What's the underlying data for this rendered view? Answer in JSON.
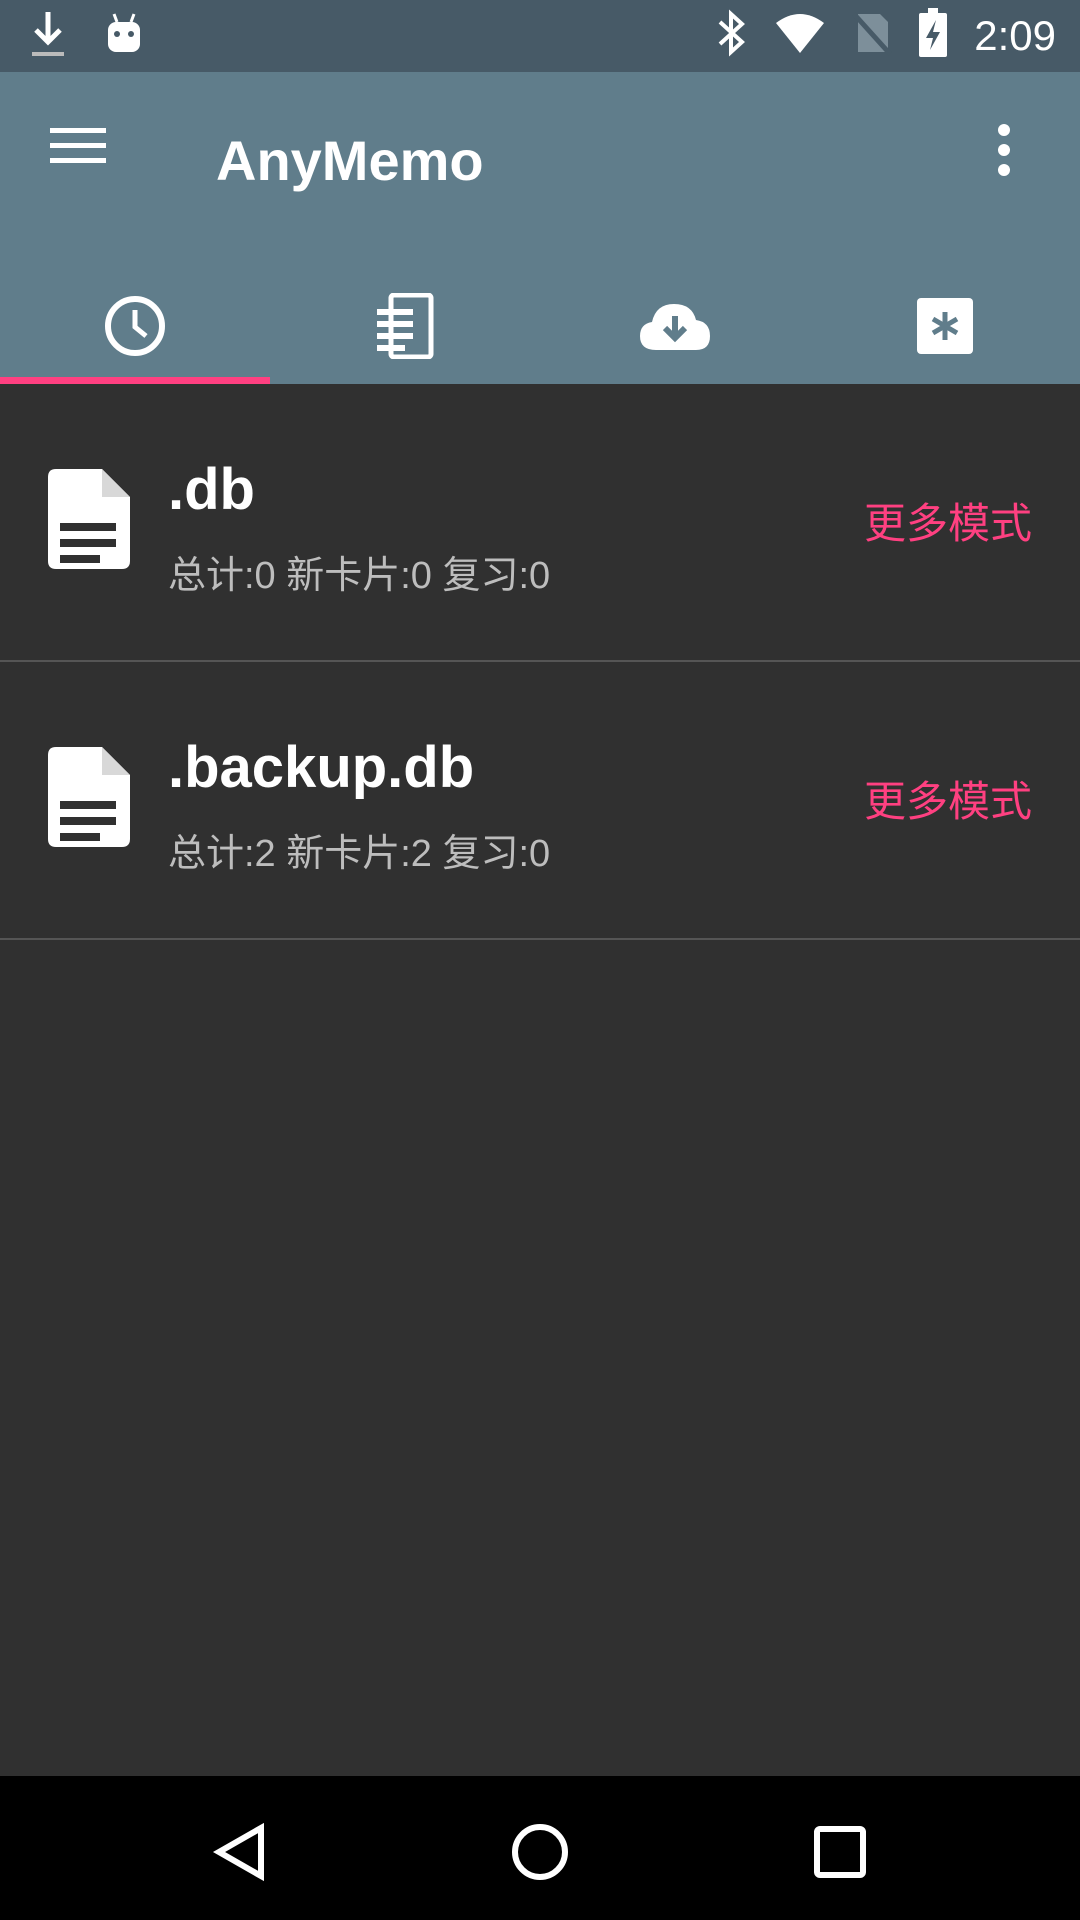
{
  "status_bar": {
    "time": "2:09",
    "icons": [
      "download-icon",
      "android-icon",
      "bluetooth-icon",
      "wifi-icon",
      "no-sim-icon",
      "battery-charging-icon"
    ]
  },
  "app_bar": {
    "title": "AnyMemo",
    "menu_icon": "hamburger-menu-icon",
    "overflow_icon": "more-vert-icon"
  },
  "tabs": [
    {
      "icon": "recent-clock-icon",
      "selected": true
    },
    {
      "icon": "file-list-icon",
      "selected": false
    },
    {
      "icon": "cloud-download-icon",
      "selected": false
    },
    {
      "icon": "misc-asterisk-icon",
      "selected": false
    }
  ],
  "files": [
    {
      "name": ".db",
      "stats": "总计:0 新卡片:0 复习:0",
      "more_label": "更多模式"
    },
    {
      "name": ".backup.db",
      "stats": "总计:2 新卡片:2 复习:0",
      "more_label": "更多模式"
    }
  ],
  "colors": {
    "status_bar": "#475a67",
    "app_bar": "#607d8b",
    "accent": "#ff4081",
    "background": "#303030"
  },
  "nav": [
    "back-icon",
    "home-icon",
    "recents-icon"
  ]
}
